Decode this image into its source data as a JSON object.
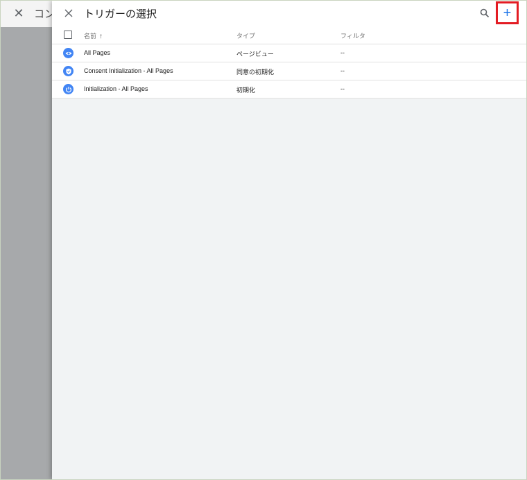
{
  "background": {
    "title": "コン"
  },
  "panel": {
    "title": "トリガーの選択",
    "add_label": "+"
  },
  "table": {
    "columns": {
      "name": "名前",
      "type": "タイプ",
      "filter": "フィルタ"
    },
    "rows": [
      {
        "icon": "eye-icon",
        "name": "All Pages",
        "type": "ページビュー",
        "filter": "--"
      },
      {
        "icon": "shield-icon",
        "name": "Consent Initialization - All Pages",
        "type": "同意の初期化",
        "filter": "--"
      },
      {
        "icon": "power-icon",
        "name": "Initialization - All Pages",
        "type": "初期化",
        "filter": "--"
      }
    ]
  },
  "colors": {
    "accent": "#1a73e8",
    "trigger_icon_bg": "#4285f4",
    "highlight_border": "#e31c23"
  }
}
